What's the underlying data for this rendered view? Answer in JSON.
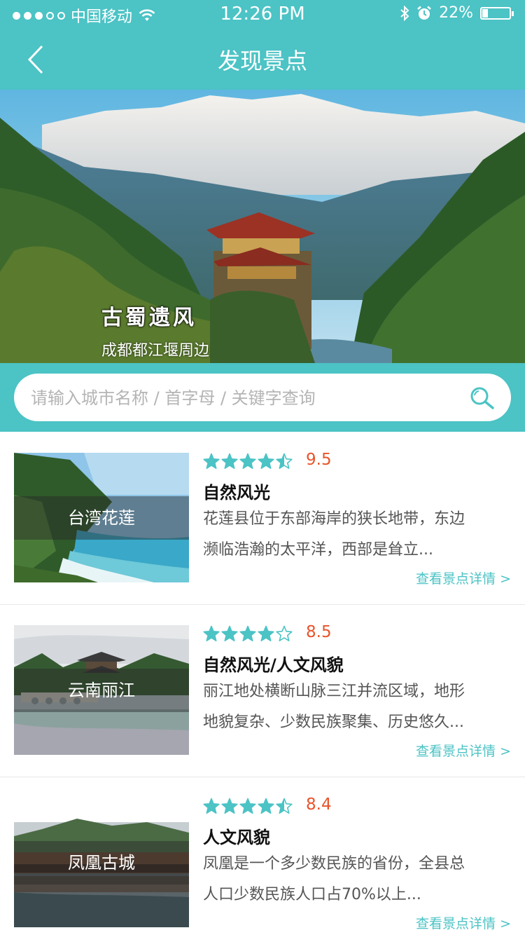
{
  "status_bar": {
    "carrier": "中国移动",
    "time": "12:26 PM",
    "battery": "22%",
    "battery_level": 0.22,
    "signal_bars_filled": 3,
    "signal_bars_total": 5
  },
  "nav": {
    "title": "发现景点"
  },
  "hero": {
    "logo_text": "古蜀遗风",
    "subtitle": "成都都江堰周边"
  },
  "search": {
    "placeholder": "请输入城市名称 / 首字母 / 关键字查询"
  },
  "colors": {
    "accent": "#4cc3c5",
    "score": "#e8542b"
  },
  "spots": [
    {
      "name": "台湾花莲",
      "rating": 4.5,
      "score": "9.5",
      "category": "自然风光",
      "desc_line1": "花莲县位于东部海岸的狭长地带，东边",
      "desc_line2": "濒临浩瀚的太平洋，西部是耸立...",
      "link": "查看景点详情 >"
    },
    {
      "name": "云南丽江",
      "rating": 4,
      "score": "8.5",
      "category": "自然风光/人文风貌",
      "desc_line1": "丽江地处横断山脉三江并流区域，地形",
      "desc_line2": "地貌复杂、少数民族聚集、历史悠久...",
      "link": "查看景点详情 >"
    },
    {
      "name": "凤凰古城",
      "rating": 4.5,
      "score": "8.4",
      "category": "人文风貌",
      "desc_line1": "凤凰是一个多少数民族的省份，全县总",
      "desc_line2": "人口少数民族人口占70%以上...",
      "link": "查看景点详情 >"
    }
  ]
}
